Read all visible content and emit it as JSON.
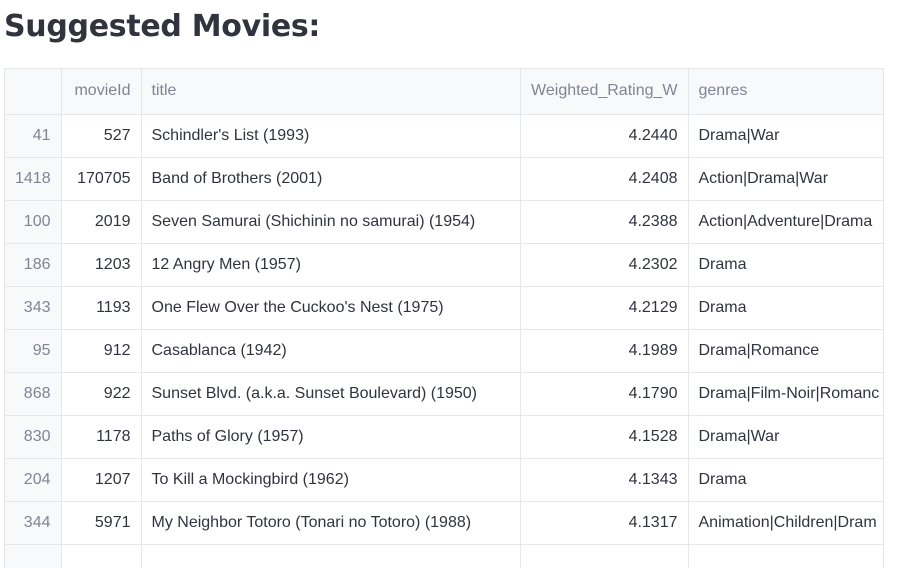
{
  "heading": "Suggested Movies:",
  "table": {
    "columns": [
      "",
      "movieId",
      "title",
      "Weighted_Rating_W",
      "genres"
    ],
    "rows": [
      {
        "index": "41",
        "movieId": "527",
        "title": "Schindler's List (1993)",
        "rating": "4.2440",
        "genres": "Drama|War"
      },
      {
        "index": "1418",
        "movieId": "170705",
        "title": "Band of Brothers (2001)",
        "rating": "4.2408",
        "genres": "Action|Drama|War"
      },
      {
        "index": "100",
        "movieId": "2019",
        "title": "Seven Samurai (Shichinin no samurai) (1954)",
        "rating": "4.2388",
        "genres": "Action|Adventure|Drama"
      },
      {
        "index": "186",
        "movieId": "1203",
        "title": "12 Angry Men (1957)",
        "rating": "4.2302",
        "genres": "Drama"
      },
      {
        "index": "343",
        "movieId": "1193",
        "title": "One Flew Over the Cuckoo's Nest (1975)",
        "rating": "4.2129",
        "genres": "Drama"
      },
      {
        "index": "95",
        "movieId": "912",
        "title": "Casablanca (1942)",
        "rating": "4.1989",
        "genres": "Drama|Romance"
      },
      {
        "index": "868",
        "movieId": "922",
        "title": "Sunset Blvd. (a.k.a. Sunset Boulevard) (1950)",
        "rating": "4.1790",
        "genres": "Drama|Film-Noir|Romanc"
      },
      {
        "index": "830",
        "movieId": "1178",
        "title": "Paths of Glory (1957)",
        "rating": "4.1528",
        "genres": "Drama|War"
      },
      {
        "index": "204",
        "movieId": "1207",
        "title": "To Kill a Mockingbird (1962)",
        "rating": "4.1343",
        "genres": "Drama"
      },
      {
        "index": "344",
        "movieId": "5971",
        "title": "My Neighbor Totoro (Tonari no Totoro) (1988)",
        "rating": "4.1317",
        "genres": "Animation|Children|Dram"
      }
    ]
  }
}
